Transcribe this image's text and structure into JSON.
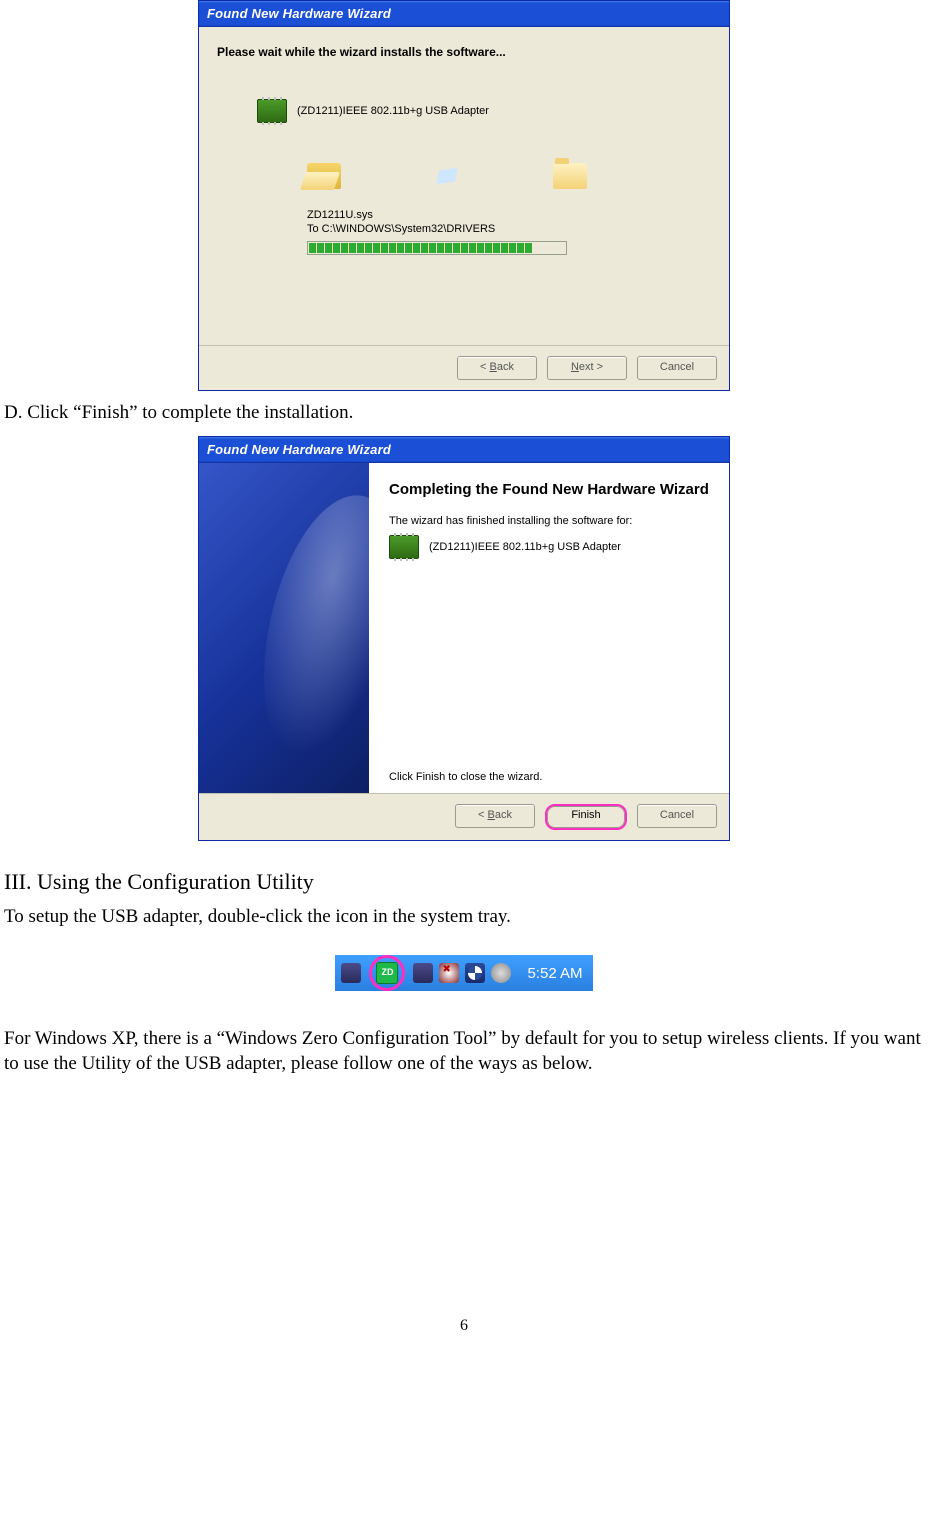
{
  "dialog1": {
    "title": "Found New Hardware Wizard",
    "instruction": "Please wait while the wizard installs the software...",
    "device_name": "(ZD1211)IEEE 802.11b+g USB Adapter",
    "filename": "ZD1211U.sys",
    "destination": "To C:\\WINDOWS\\System32\\DRIVERS",
    "buttons": {
      "back": "< Back",
      "next": "Next >",
      "cancel": "Cancel"
    },
    "progress_segments": 28
  },
  "body": {
    "step_d": "D. Click “Finish” to complete the installation.",
    "section_heading": "III. Using the Configuration Utility",
    "setup_text": "To setup the USB adapter, double-click the icon in the system tray.",
    "xp_note": "For Windows XP, there is a “Windows Zero Configuration Tool” by default for you to setup wireless clients. If you want to use the Utility of the USB adapter, please follow one of the ways as below.",
    "page_number": "6"
  },
  "dialog2": {
    "title": "Found New Hardware Wizard",
    "heading": "Completing the Found New Hardware Wizard",
    "subtext": "The wizard has finished installing the software for:",
    "device_name": "(ZD1211)IEEE 802.11b+g USB Adapter",
    "close_text": "Click Finish to close the wizard.",
    "buttons": {
      "back": "< Back",
      "finish": "Finish",
      "cancel": "Cancel"
    }
  },
  "systray": {
    "zd_label": "ZD",
    "time": "5:52 AM"
  }
}
